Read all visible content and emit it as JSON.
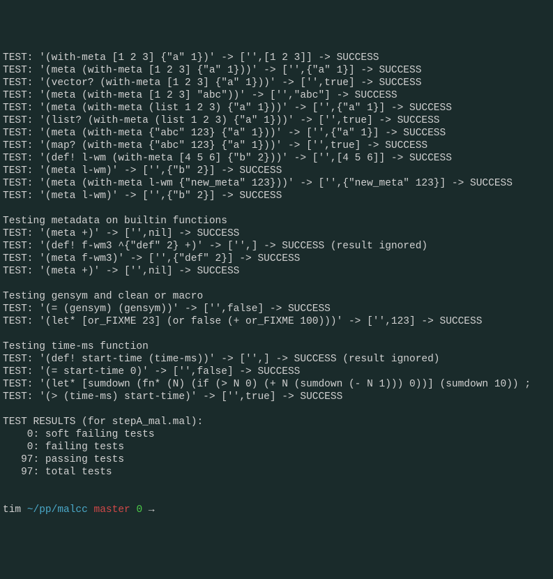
{
  "lines": [
    "TEST: '(with-meta [1 2 3] {\"a\" 1})' -> ['',[1 2 3]] -> SUCCESS",
    "TEST: '(meta (with-meta [1 2 3] {\"a\" 1}))' -> ['',{\"a\" 1}] -> SUCCESS",
    "TEST: '(vector? (with-meta [1 2 3] {\"a\" 1}))' -> ['',true] -> SUCCESS",
    "TEST: '(meta (with-meta [1 2 3] \"abc\"))' -> ['',\"abc\"] -> SUCCESS",
    "TEST: '(meta (with-meta (list 1 2 3) {\"a\" 1}))' -> ['',{\"a\" 1}] -> SUCCESS",
    "TEST: '(list? (with-meta (list 1 2 3) {\"a\" 1}))' -> ['',true] -> SUCCESS",
    "TEST: '(meta (with-meta {\"abc\" 123} {\"a\" 1}))' -> ['',{\"a\" 1}] -> SUCCESS",
    "TEST: '(map? (with-meta {\"abc\" 123} {\"a\" 1}))' -> ['',true] -> SUCCESS",
    "TEST: '(def! l-wm (with-meta [4 5 6] {\"b\" 2}))' -> ['',[4 5 6]] -> SUCCESS",
    "TEST: '(meta l-wm)' -> ['',{\"b\" 2}] -> SUCCESS",
    "TEST: '(meta (with-meta l-wm {\"new_meta\" 123}))' -> ['',{\"new_meta\" 123}] -> SUCCESS",
    "TEST: '(meta l-wm)' -> ['',{\"b\" 2}] -> SUCCESS",
    "",
    "Testing metadata on builtin functions",
    "TEST: '(meta +)' -> ['',nil] -> SUCCESS",
    "TEST: '(def! f-wm3 ^{\"def\" 2} +)' -> ['',] -> SUCCESS (result ignored)",
    "TEST: '(meta f-wm3)' -> ['',{\"def\" 2}] -> SUCCESS",
    "TEST: '(meta +)' -> ['',nil] -> SUCCESS",
    "",
    "Testing gensym and clean or macro",
    "TEST: '(= (gensym) (gensym))' -> ['',false] -> SUCCESS",
    "TEST: '(let* [or_FIXME 23] (or false (+ or_FIXME 100)))' -> ['',123] -> SUCCESS",
    "",
    "Testing time-ms function",
    "TEST: '(def! start-time (time-ms))' -> ['',] -> SUCCESS (result ignored)",
    "TEST: '(= start-time 0)' -> ['',false] -> SUCCESS",
    "TEST: '(let* [sumdown (fn* (N) (if (> N 0) (+ N (sumdown (- N 1))) 0))] (sumdown 10)) ;",
    "TEST: '(> (time-ms) start-time)' -> ['',true] -> SUCCESS",
    "",
    "TEST RESULTS (for stepA_mal.mal):",
    "    0: soft failing tests",
    "    0: failing tests",
    "   97: passing tests",
    "   97: total tests",
    ""
  ],
  "prompt": {
    "user": "tim ",
    "path": "~/pp/malcc",
    "sep1": " ",
    "branch": "master",
    "sep2": " ",
    "status": "0",
    "sep3": " ",
    "arrow": "→ "
  }
}
